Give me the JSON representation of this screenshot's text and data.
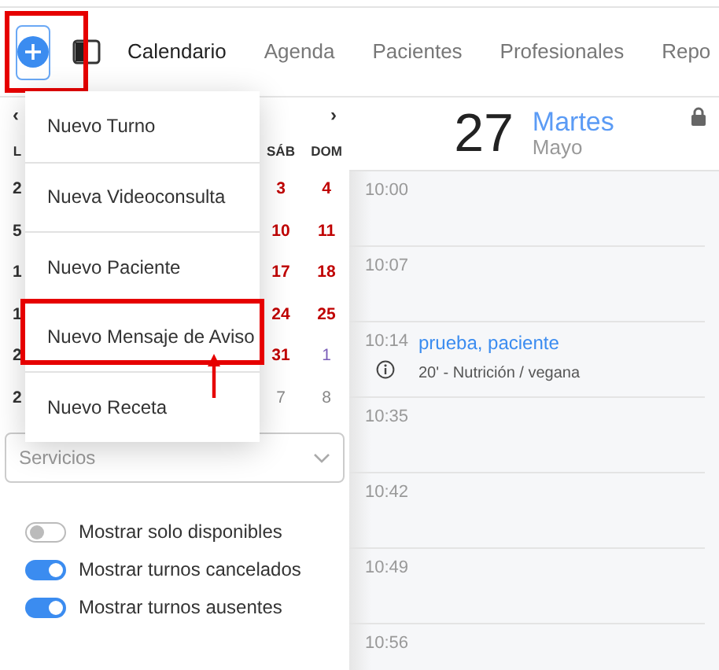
{
  "toolbar": {
    "add_button": {
      "highlighted": true
    },
    "nav": [
      {
        "label": "Calendario",
        "selected": true
      },
      {
        "label": "Agenda",
        "selected": false
      },
      {
        "label": "Pacientes",
        "selected": false
      },
      {
        "label": "Profesionales",
        "selected": false
      },
      {
        "label": "Repo",
        "selected": false
      }
    ]
  },
  "mini_calendar": {
    "prev": "‹",
    "next": "›",
    "left_header": "L",
    "right_headers": [
      "SÁB",
      "DOM"
    ],
    "left_days": [
      "2",
      "5",
      "1",
      "1",
      "2",
      "2"
    ],
    "right_days": [
      [
        {
          "label": "3",
          "kind": "weekend"
        },
        {
          "label": "4",
          "kind": "weekend"
        }
      ],
      [
        {
          "label": "10",
          "kind": "weekend"
        },
        {
          "label": "11",
          "kind": "weekend"
        }
      ],
      [
        {
          "label": "17",
          "kind": "weekend"
        },
        {
          "label": "18",
          "kind": "weekend"
        }
      ],
      [
        {
          "label": "24",
          "kind": "weekend"
        },
        {
          "label": "25",
          "kind": "weekend"
        }
      ],
      [
        {
          "label": "31",
          "kind": "weekend"
        },
        {
          "label": "1",
          "kind": "next"
        }
      ],
      [
        {
          "label": "7",
          "kind": "muted"
        },
        {
          "label": "8",
          "kind": "muted"
        }
      ]
    ]
  },
  "services": {
    "placeholder": "Servicios"
  },
  "switches": [
    {
      "label": "Mostrar solo disponibles",
      "on": false
    },
    {
      "label": "Mostrar turnos cancelados",
      "on": true
    },
    {
      "label": "Mostrar turnos ausentes",
      "on": true
    }
  ],
  "menu": [
    {
      "label": "Nuevo Turno",
      "highlighted": false
    },
    {
      "label": "Nueva Videoconsulta",
      "highlighted": false
    },
    {
      "label": "Nuevo Paciente",
      "highlighted": false
    },
    {
      "label": "Nuevo Mensaje de Aviso",
      "highlighted": true
    },
    {
      "label": "Nuevo Receta",
      "highlighted": false
    }
  ],
  "day": {
    "number": "27",
    "weekday": "Martes",
    "month": "Mayo",
    "locked": true
  },
  "slots": [
    {
      "time": "10:00"
    },
    {
      "time": "10:07"
    },
    {
      "time": "10:14",
      "event": {
        "patient": "prueba, paciente",
        "detail": "20' - Nutrición / vegana"
      }
    },
    {
      "time": "10:35"
    },
    {
      "time": "10:42"
    },
    {
      "time": "10:49"
    },
    {
      "time": "10:56"
    }
  ]
}
